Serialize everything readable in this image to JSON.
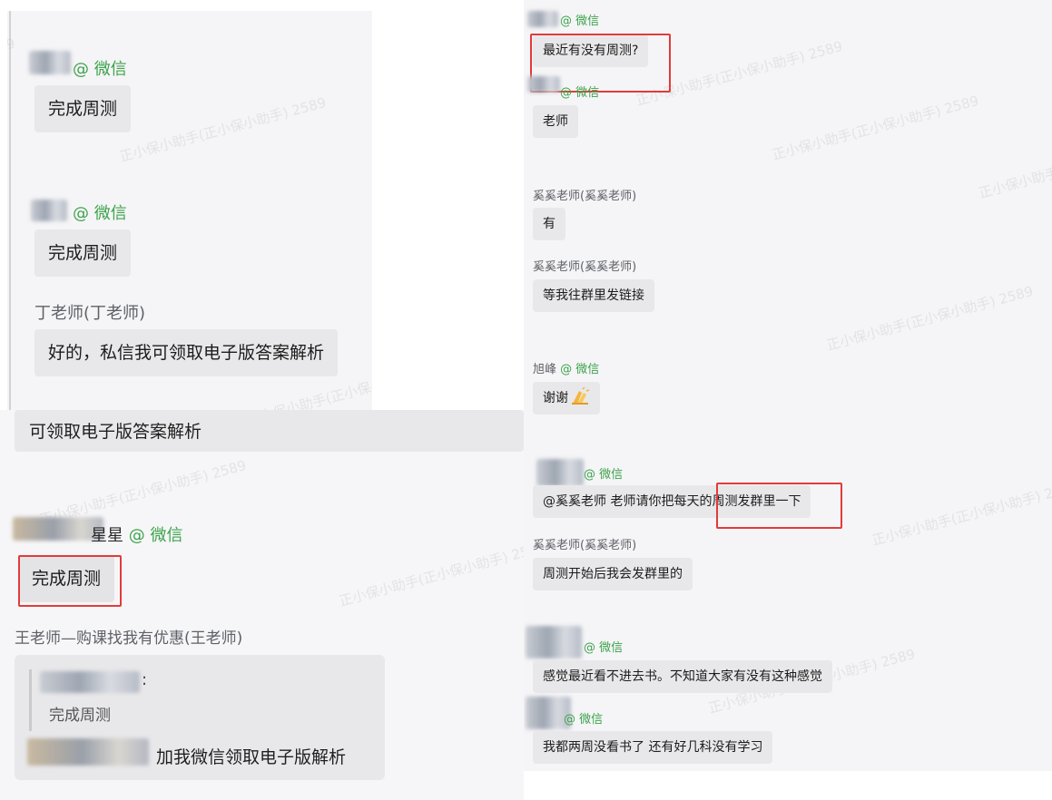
{
  "left_panel": {
    "msg1": {
      "sender_suffix": "@ 微信",
      "text": "完成周测"
    },
    "msg2": {
      "sender_suffix": "@ 微信",
      "text": "完成周测"
    },
    "msg3": {
      "sender": "丁老师(丁老师)",
      "text": "好的，私信我可领取电子版答案解析"
    },
    "quote_bar": {
      "text": "可领取电子版答案解析"
    },
    "msg4": {
      "sender_visible": "星星",
      "sender_suffix": "@ 微信",
      "text": "完成周测"
    },
    "msg5": {
      "sender": "王老师—购课找我有优惠(王老师)",
      "quote_suffix": ":",
      "quote_text": "完成周测",
      "reply_text": "加我微信领取电子版解析"
    }
  },
  "right_panel": {
    "m1": {
      "sender_suffix": "@ 微信",
      "text": "最近有没有周测?"
    },
    "m2": {
      "sender_suffix": "@ 微信",
      "text": "老师"
    },
    "m3": {
      "sender": "奚奚老师(奚奚老师)",
      "text": "有"
    },
    "m4": {
      "sender": "奚奚老师(奚奚老师)",
      "text": "等我往群里发链接"
    },
    "m5": {
      "sender_name": "旭峰",
      "sender_suffix": "@ 微信",
      "text": "谢谢",
      "emoji_icon": "clapping-hands-icon"
    },
    "m6": {
      "sender_suffix": "@ 微信",
      "text": "@奚奚老师 老师请你把每天的周测发群里一下"
    },
    "m7": {
      "sender": "奚奚老师(奚奚老师)",
      "text": "周测开始后我会发群里的"
    },
    "m8": {
      "sender_suffix": "@ 微信",
      "text": "感觉最近看不进去书。不知道大家有没有这种感觉"
    },
    "m9": {
      "sender_suffix": "@ 微信",
      "text": "我都两周没看书了 还有好几科没有学习"
    }
  },
  "watermark": {
    "text": "正小保小助手(正小保小助手) 2589"
  },
  "colors": {
    "highlight": "#e23b3b",
    "wechat_green": "#3ea34c",
    "bubble": "#e8e8ea",
    "panel": "#f5f5f7"
  }
}
